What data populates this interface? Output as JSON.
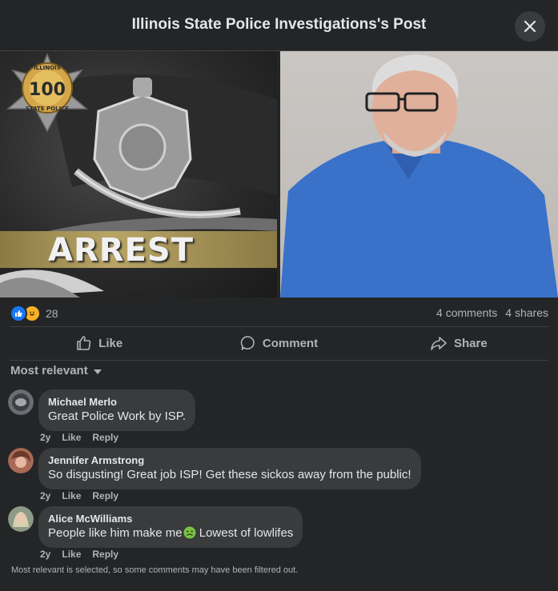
{
  "header": {
    "title": "Illinois State Police Investigations's Post"
  },
  "post": {
    "image_left": {
      "banner_text": "ARREST",
      "badge_top": "ILLINOIS",
      "badge_number": "100",
      "badge_bottom": "STATE POLICE"
    }
  },
  "stats": {
    "reaction_count": "28",
    "comments": "4 comments",
    "shares": "4 shares"
  },
  "actions": {
    "like": "Like",
    "comment": "Comment",
    "share": "Share"
  },
  "sort": {
    "label": "Most relevant"
  },
  "comments": [
    {
      "name": "Michael Merlo",
      "text": "Great Police Work by ISP.",
      "age": "2y",
      "like": "Like",
      "reply": "Reply"
    },
    {
      "name": "Jennifer Armstrong",
      "text": "So disgusting! Great job ISP! Get these sickos away from the public!",
      "age": "2y",
      "like": "Like",
      "reply": "Reply"
    },
    {
      "name": "Alice McWilliams",
      "text": "People like him make me",
      "text_after": " Lowest of lowlifes",
      "age": "2y",
      "like": "Like",
      "reply": "Reply"
    }
  ],
  "footer": {
    "note": "Most relevant is selected, so some comments may have been filtered out."
  },
  "colors": {
    "background": "#242526",
    "bubble": "#3a3b3c",
    "text_primary": "#e4e6eb",
    "text_secondary": "#b0b3b8",
    "like_blue": "#1877f2"
  }
}
